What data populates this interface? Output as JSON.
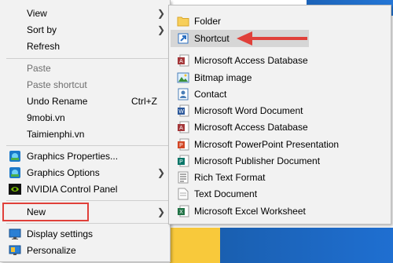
{
  "context_menu": {
    "items": [
      {
        "label": "View",
        "submenu": true
      },
      {
        "label": "Sort by",
        "submenu": true
      },
      {
        "label": "Refresh"
      },
      {
        "label": "Paste",
        "disabled": true
      },
      {
        "label": "Paste shortcut",
        "disabled": true
      },
      {
        "label": "Undo Rename",
        "shortcut": "Ctrl+Z"
      },
      {
        "label": "9mobi.vn"
      },
      {
        "label": "Taimienphi.vn"
      },
      {
        "label": "Graphics Properties..."
      },
      {
        "label": "Graphics Options",
        "submenu": true
      },
      {
        "label": "NVIDIA Control Panel"
      },
      {
        "label": "New",
        "submenu": true
      },
      {
        "label": "Display settings"
      },
      {
        "label": "Personalize"
      }
    ]
  },
  "new_submenu": {
    "items": [
      {
        "label": "Folder"
      },
      {
        "label": "Shortcut"
      },
      {
        "label": "Microsoft Access Database"
      },
      {
        "label": "Bitmap image"
      },
      {
        "label": "Contact"
      },
      {
        "label": "Microsoft Word Document"
      },
      {
        "label": "Microsoft Access Database"
      },
      {
        "label": "Microsoft PowerPoint Presentation"
      },
      {
        "label": "Microsoft Publisher Document"
      },
      {
        "label": "Rich Text Format"
      },
      {
        "label": "Text Document"
      },
      {
        "label": "Microsoft Excel Worksheet"
      }
    ]
  },
  "colors": {
    "annotation_red": "#e0403a",
    "menu_bg": "#f2f2f2",
    "highlight_gray": "#d6d6d6"
  }
}
